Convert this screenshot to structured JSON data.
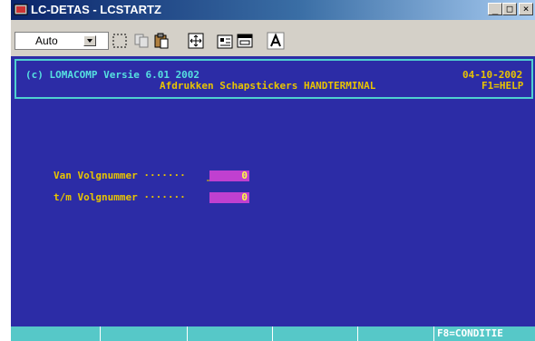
{
  "window": {
    "title": "LC-DETAS - LCSTARTZ",
    "minimize": "_",
    "maximize": "□",
    "close": "×"
  },
  "toolbar": {
    "font_size": "Auto",
    "tools": [
      "mark-icon",
      "copy-icon",
      "paste-icon",
      "fullscreen-icon",
      "properties-icon",
      "background-icon",
      "font-icon"
    ]
  },
  "terminal": {
    "copyright": "(c) LOMACOMP Versie 6.01 2002",
    "subtitle": "Afdrukken Schapstickers HANDTERMINAL",
    "date": "04-10-2002",
    "help": "F1=HELP",
    "fields": [
      {
        "label": "Van Volgnummer ·······",
        "value": "0",
        "cursor": "_"
      },
      {
        "label": "t/m Volgnummer ·······",
        "value": "0",
        "cursor": ""
      }
    ],
    "status": "F8=CONDITIE"
  },
  "colors": {
    "background": "#2c2ca6",
    "label": "#e8c400",
    "header_text": "#56e0e0",
    "field_bg": "#c040d0",
    "status_bar": "#56c8c8"
  }
}
